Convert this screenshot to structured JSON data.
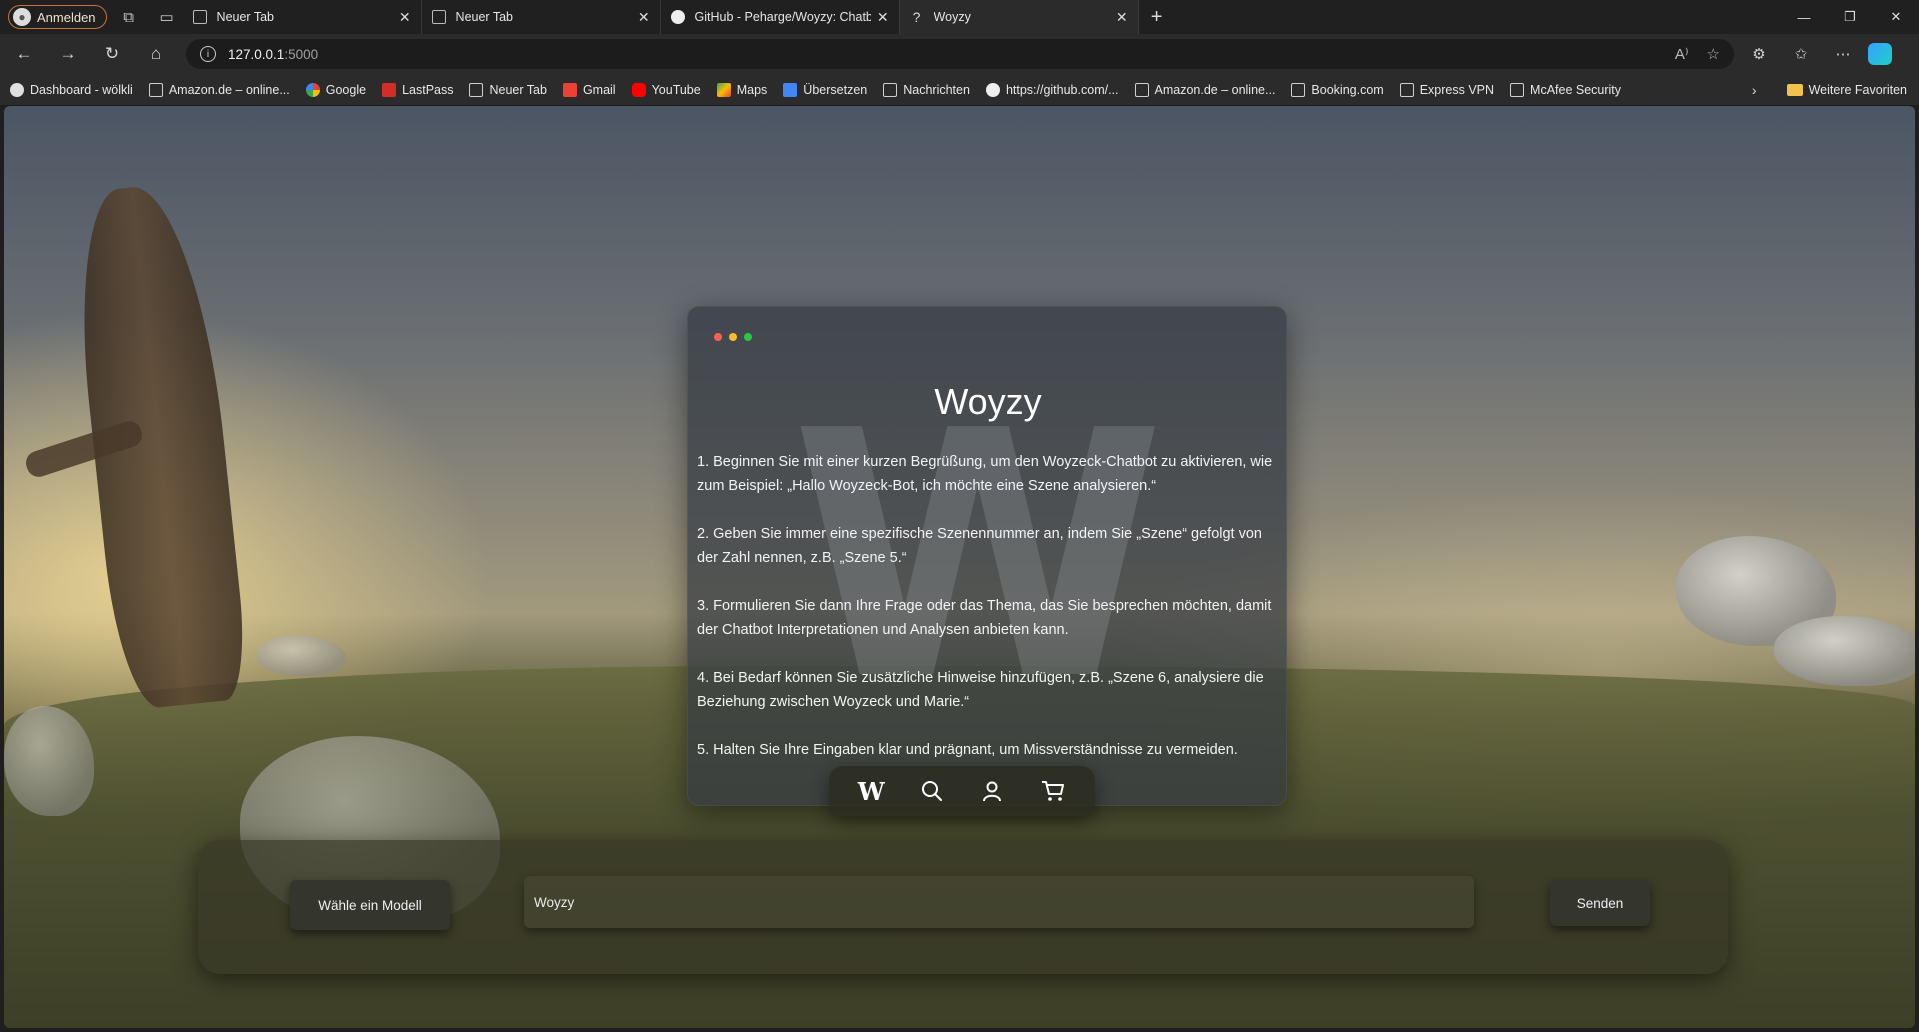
{
  "browser": {
    "profile_label": "Anmelden",
    "tabs": [
      {
        "title": "Neuer Tab",
        "active": false
      },
      {
        "title": "Neuer Tab",
        "active": false
      },
      {
        "title": "GitHub - Peharge/Woyzy: Chatbo",
        "active": false
      },
      {
        "title": "Woyzy",
        "active": true
      }
    ],
    "url_host": "127.0.0.1",
    "url_port": ":5000",
    "bookmarks": [
      "Dashboard - wölkli",
      "Amazon.de – online...",
      "Google",
      "LastPass",
      "Neuer Tab",
      "Gmail",
      "YouTube",
      "Maps",
      "Übersetzen",
      "Nachrichten",
      "https://github.com/...",
      "Amazon.de – online...",
      "Booking.com",
      "Express VPN",
      "McAfee Security"
    ],
    "bookmarks_folder": "Weitere Favoriten"
  },
  "card": {
    "title": "Woyzy",
    "watermark": "W",
    "dot_colors": [
      "#ff5f57",
      "#febc2e",
      "#28c840"
    ],
    "steps": [
      "1. Beginnen Sie mit einer kurzen Begrüßung, um den Woyzeck-Chatbot zu aktivieren, wie zum Beispiel: „Hallo Woyzeck-Bot, ich möchte eine Szene analysieren.“",
      "2. Geben Sie immer eine spezifische Szenennummer an, indem Sie „Szene“ gefolgt von der Zahl nennen, z.B. „Szene 5.“",
      "3. Formulieren Sie dann Ihre Frage oder das Thema, das Sie besprechen möchten, damit der Chatbot Interpretationen und Analysen anbieten kann.",
      "4. Bei Bedarf können Sie zusätzliche Hinweise hinzufügen, z.B. „Szene 6, analysiere die Beziehung zwischen Woyzeck und Marie.“",
      "5. Halten Sie Ihre Eingaben klar und prägnant, um Missverständnisse zu vermeiden."
    ]
  },
  "dock": {
    "logo_letter": "W",
    "icons": [
      "w-logo-icon",
      "search-icon",
      "user-icon",
      "cart-icon"
    ]
  },
  "chat": {
    "model_button": "Wähle ein Modell",
    "input_value": "Woyzy",
    "send_button": "Senden"
  }
}
